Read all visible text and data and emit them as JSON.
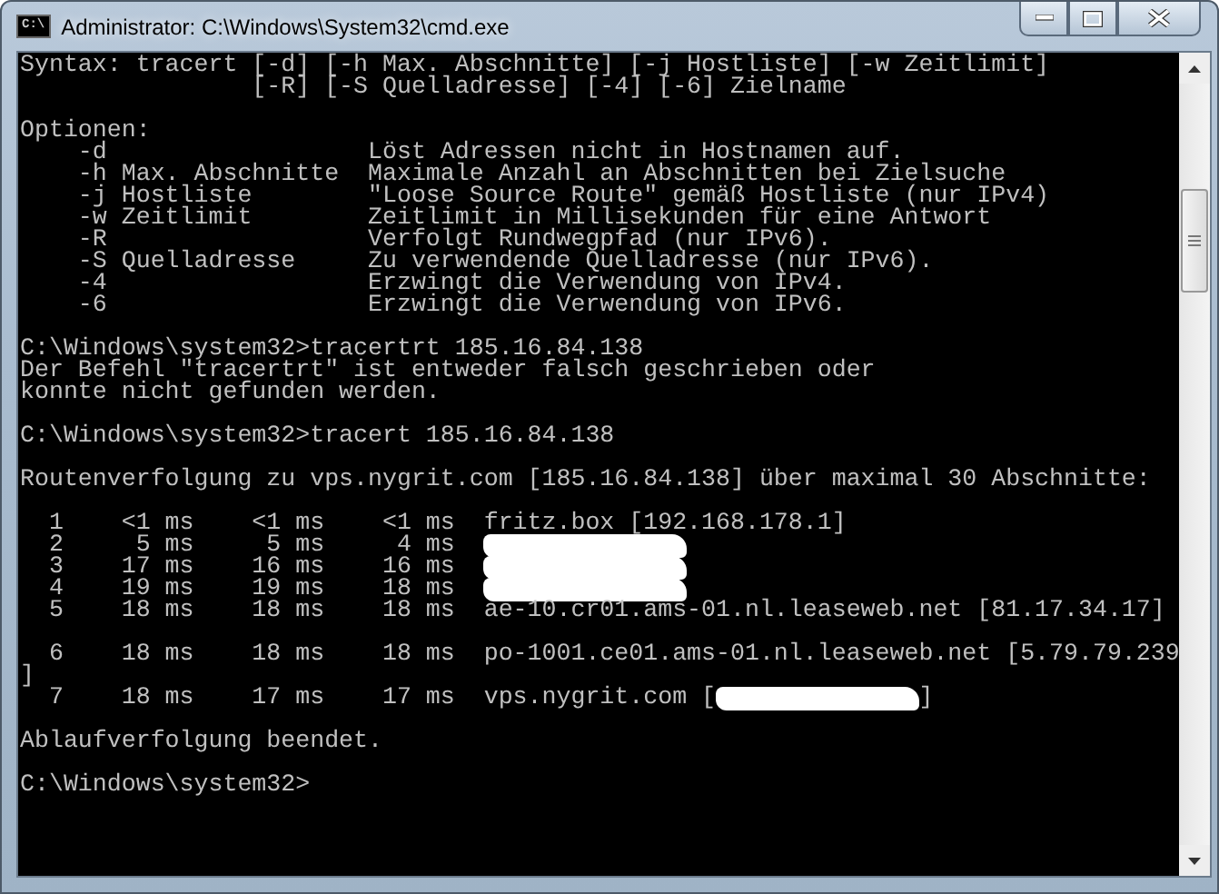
{
  "window": {
    "title": "Administrator: C:\\Windows\\System32\\cmd.exe",
    "icon_text": "C:\\"
  },
  "console": [
    {
      "text": "Syntax: tracert [-d] [-h Max. Abschnitte] [-j Hostliste] [-w Zeitlimit]",
      "blank_before": false
    },
    {
      "text": "                [-R] [-S Quelladresse] [-4] [-6] Zielname",
      "blank_before": false
    },
    {
      "text": "Optionen:",
      "blank_before": true
    },
    {
      "text": "    -d                  Löst Adressen nicht in Hostnamen auf.",
      "blank_before": false
    },
    {
      "text": "    -h Max. Abschnitte  Maximale Anzahl an Abschnitten bei Zielsuche",
      "blank_before": false
    },
    {
      "text": "    -j Hostliste        \"Loose Source Route\" gemäß Hostliste (nur IPv4)",
      "blank_before": false
    },
    {
      "text": "    -w Zeitlimit        Zeitlimit in Millisekunden für eine Antwort",
      "blank_before": false
    },
    {
      "text": "    -R                  Verfolgt Rundwegpfad (nur IPv6).",
      "blank_before": false
    },
    {
      "text": "    -S Quelladresse     Zu verwendende Quelladresse (nur IPv6).",
      "blank_before": false
    },
    {
      "text": "    -4                  Erzwingt die Verwendung von IPv4.",
      "blank_before": false
    },
    {
      "text": "    -6                  Erzwingt die Verwendung von IPv6.",
      "blank_before": false
    },
    {
      "text": "C:\\Windows\\system32>tracertrt 185.16.84.138",
      "blank_before": true
    },
    {
      "text": "Der Befehl \"tracertrt\" ist entweder falsch geschrieben oder",
      "blank_before": false
    },
    {
      "text": "konnte nicht gefunden werden.",
      "blank_before": false
    },
    {
      "text": "C:\\Windows\\system32>tracert 185.16.84.138",
      "blank_before": true
    },
    {
      "text": "Routenverfolgung zu vps.nygrit.com [185.16.84.138] über maximal 30 Abschnitte:",
      "blank_before": true
    },
    {
      "text": "  1    <1 ms    <1 ms    <1 ms  fritz.box [192.168.178.1]",
      "blank_before": true
    },
    {
      "text": "  2     5 ms     5 ms     4 ms  ",
      "redacted": true,
      "blank_before": false
    },
    {
      "text": "  3    17 ms    16 ms    16 ms  ",
      "redacted": true,
      "blank_before": false
    },
    {
      "text": "  4    19 ms    19 ms    18 ms  ",
      "redacted": true,
      "blank_before": false
    },
    {
      "text": "  5    18 ms    18 ms    18 ms  ae-10.cr01.ams-01.nl.leaseweb.net [81.17.34.17]",
      "blank_before": false
    },
    {
      "text": "  6    18 ms    18 ms    18 ms  po-1001.ce01.ams-01.nl.leaseweb.net [5.79.79.239",
      "blank_before": true
    },
    {
      "text": "]",
      "blank_before": false
    },
    {
      "text": "  7    18 ms    17 ms    17 ms  vps.nygrit.com [",
      "redacted": true,
      "tail": "]",
      "blank_before": false
    },
    {
      "text": "Ablaufverfolgung beendet.",
      "blank_before": true
    },
    {
      "text": "C:\\Windows\\system32>",
      "blank_before": true
    }
  ]
}
